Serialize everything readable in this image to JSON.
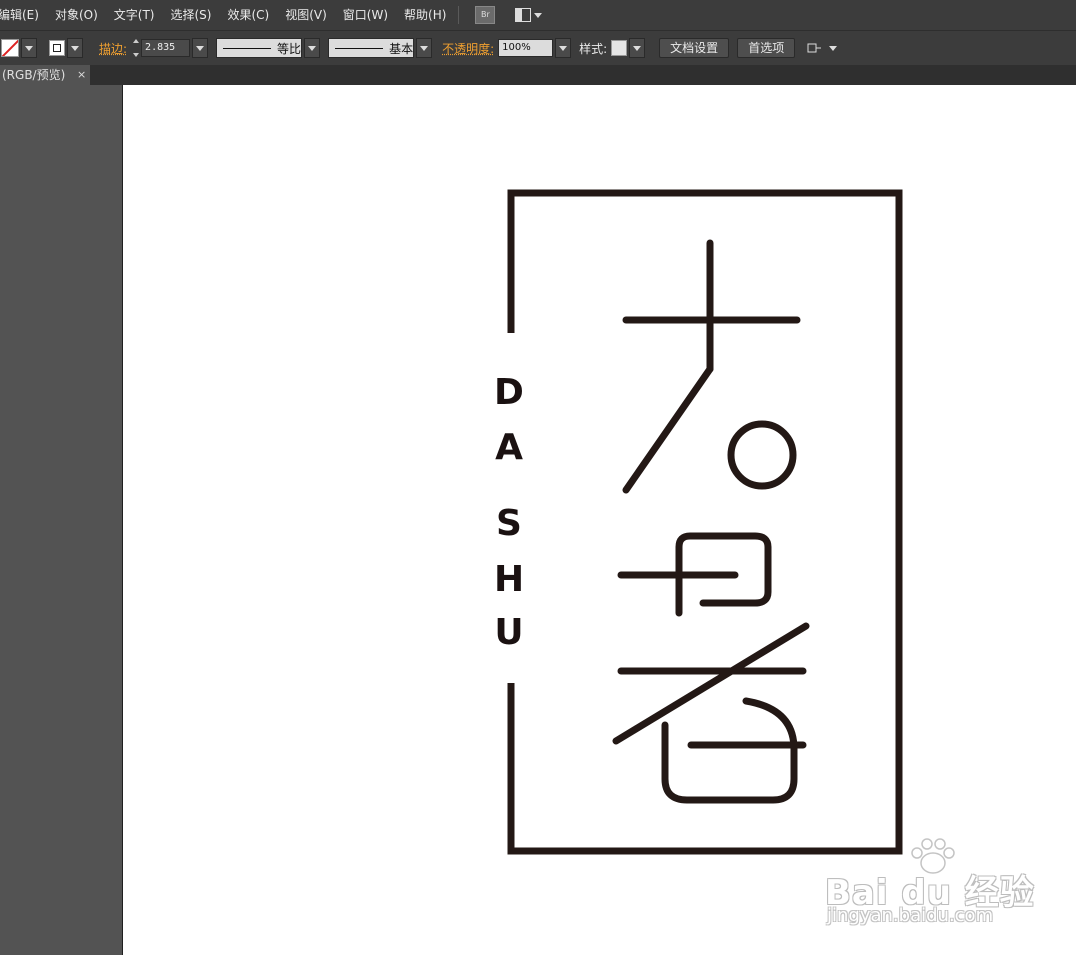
{
  "menu": {
    "items": [
      "编辑(E)",
      "对象(O)",
      "文字(T)",
      "选择(S)",
      "效果(C)",
      "视图(V)",
      "窗口(W)",
      "帮助(H)"
    ],
    "bridge_label": "Br"
  },
  "control": {
    "stroke_label": "描边:",
    "stroke_value": "2.835",
    "profile_label": "等比",
    "brush_label": "基本",
    "opacity_label": "不透明度:",
    "opacity_value": "100%",
    "style_label": "样式:",
    "doc_setup_button": "文档设置",
    "preferences_button": "首选项"
  },
  "tab": {
    "label": "(RGB/预览)",
    "close": "×"
  },
  "artwork": {
    "vertical_letters": [
      "D",
      "A",
      "S",
      "H",
      "U"
    ],
    "stroke_color": "#231815"
  },
  "watermark": {
    "main": "Bai du 经验",
    "sub": "jingyan.baidu.com"
  },
  "icons": [
    "fill-swatch-icon",
    "stroke-swatch-icon",
    "layout-icon",
    "flyout-icon",
    "close-icon"
  ]
}
